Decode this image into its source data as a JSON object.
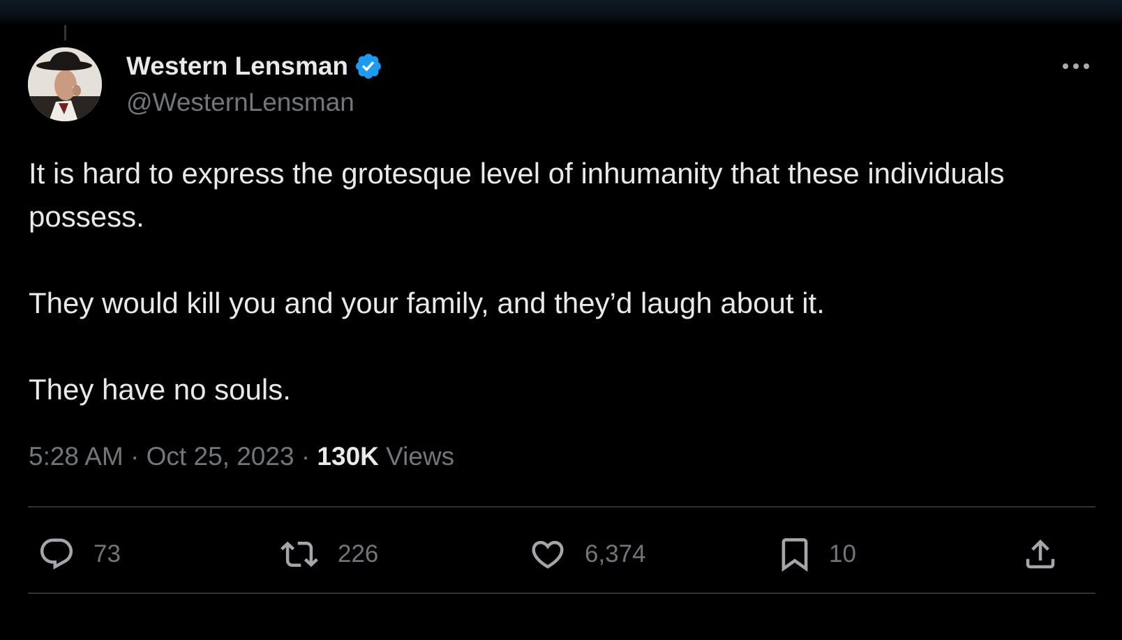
{
  "tweet": {
    "author": {
      "display_name": "Western Lensman",
      "handle": "@WesternLensman",
      "verified": true
    },
    "text_paragraphs": [
      "It is hard to express the grotesque level of inhumanity that these individuals possess.",
      "They would kill you and your family, and they’d laugh about it.",
      "They have no souls."
    ],
    "time": "5:28 AM",
    "separator": "·",
    "date": "Oct 25, 2023",
    "views_count": "130K",
    "views_label": "Views"
  },
  "actions": {
    "replies": "73",
    "reposts": "226",
    "likes": "6,374",
    "bookmarks": "10"
  },
  "icons": {
    "more": "more-horizontal-icon",
    "verified": "verified-badge-icon",
    "reply": "reply-icon",
    "repost": "repost-icon",
    "like": "heart-icon",
    "bookmark": "bookmark-icon",
    "share": "share-icon"
  },
  "colors": {
    "background": "#000000",
    "text_primary": "#e7e9ea",
    "text_secondary": "#71767b",
    "divider": "#2f3336",
    "verified_blue": "#1d9bf0"
  }
}
